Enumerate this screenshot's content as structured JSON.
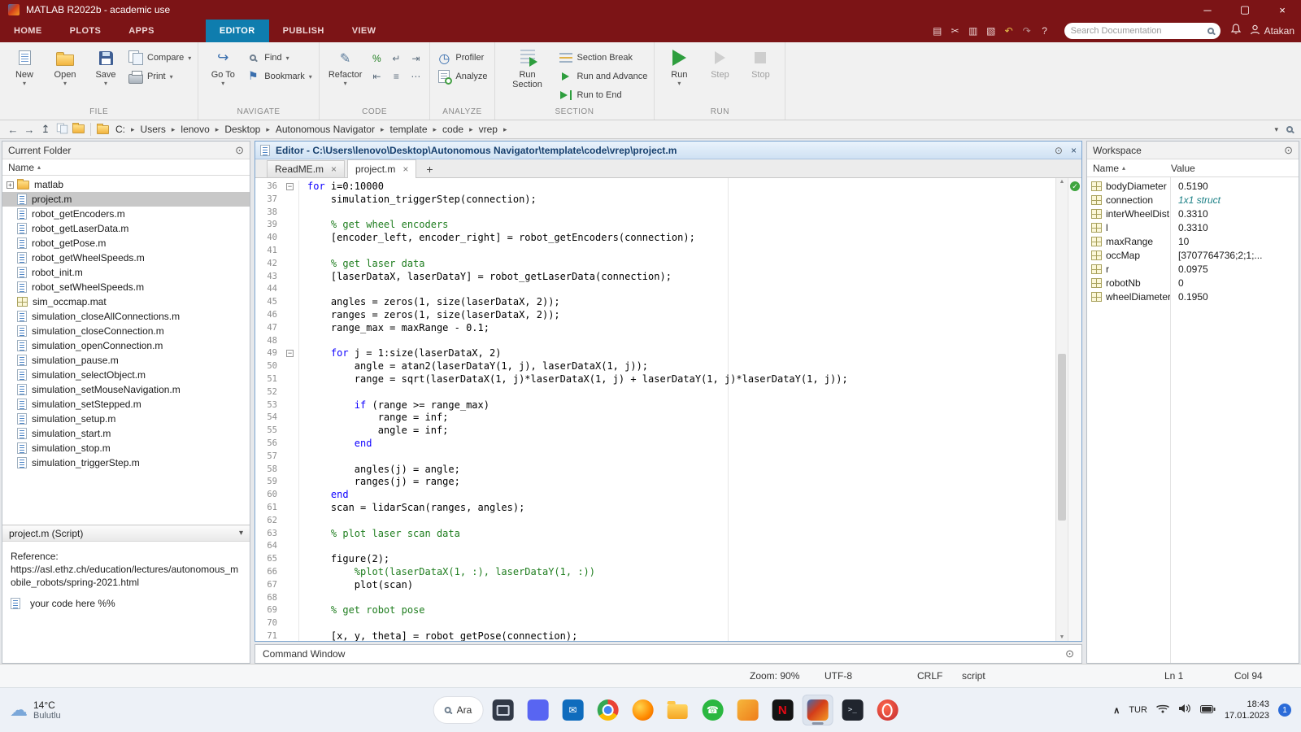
{
  "window": {
    "title": "MATLAB R2022b - academic use"
  },
  "ribbon": {
    "tabs": [
      {
        "label": "HOME"
      },
      {
        "label": "PLOTS"
      },
      {
        "label": "APPS"
      },
      {
        "label": "EDITOR",
        "active": true,
        "gap_before": true
      },
      {
        "label": "PUBLISH"
      },
      {
        "label": "VIEW"
      }
    ],
    "quick_access": [
      "save",
      "cut",
      "copy",
      "paste",
      "undo",
      "redo",
      "help"
    ],
    "search_placeholder": "Search Documentation",
    "user": "Atakan",
    "sections": [
      {
        "label": "FILE",
        "big": [
          {
            "label": "New",
            "icon": "new",
            "arrow": true
          },
          {
            "label": "Open",
            "icon": "open",
            "arrow": true
          },
          {
            "label": "Save",
            "icon": "save",
            "arrow": true
          }
        ],
        "small": [
          {
            "label": "Compare",
            "icon": "compare",
            "arrow": true
          },
          {
            "label": "Print",
            "icon": "print",
            "arrow": true
          }
        ]
      },
      {
        "label": "NAVIGATE",
        "big": [
          {
            "label": "Go To",
            "icon": "goto",
            "arrow": true
          }
        ],
        "small": [
          {
            "label": "Find",
            "icon": "find",
            "arrow": true
          },
          {
            "label": "Bookmark",
            "icon": "bookmark",
            "arrow": true
          }
        ]
      },
      {
        "label": "CODE",
        "big": [
          {
            "label": "Refactor",
            "icon": "refactor",
            "arrow": true
          }
        ],
        "grid": [
          [
            "percent",
            "wrap",
            "indent-right"
          ],
          [
            "indent-left",
            "lines",
            "more"
          ]
        ]
      },
      {
        "label": "ANALYZE",
        "small": [
          {
            "label": "Profiler",
            "icon": "profiler"
          },
          {
            "label": "Analyze",
            "icon": "analyze"
          }
        ]
      },
      {
        "label": "SECTION",
        "big": [
          {
            "label": "Run Section",
            "icon": "run-section"
          }
        ],
        "small": [
          {
            "label": "Section Break",
            "icon": "section-break"
          },
          {
            "label": "Run and Advance",
            "icon": "run-advance"
          },
          {
            "label": "Run to End",
            "icon": "run-end"
          }
        ]
      },
      {
        "label": "RUN",
        "big": [
          {
            "label": "Run",
            "icon": "run",
            "arrow": true
          },
          {
            "label": "Step",
            "icon": "step",
            "disabled": true
          },
          {
            "label": "Stop",
            "icon": "stop",
            "disabled": true
          }
        ]
      }
    ]
  },
  "address_bar": {
    "path": [
      "C:",
      "Users",
      "lenovo",
      "Desktop",
      "Autonomous Navigator",
      "template",
      "code",
      "vrep"
    ]
  },
  "current_folder": {
    "title": "Current Folder",
    "name_header": "Name",
    "files": [
      {
        "name": "matlab",
        "icon": "folder",
        "expandable": true
      },
      {
        "name": "project.m",
        "icon": "mfile",
        "selected": true
      },
      {
        "name": "robot_getEncoders.m",
        "icon": "mfile"
      },
      {
        "name": "robot_getLaserData.m",
        "icon": "mfile"
      },
      {
        "name": "robot_getPose.m",
        "icon": "mfile"
      },
      {
        "name": "robot_getWheelSpeeds.m",
        "icon": "mfile"
      },
      {
        "name": "robot_init.m",
        "icon": "mfile"
      },
      {
        "name": "robot_setWheelSpeeds.m",
        "icon": "mfile"
      },
      {
        "name": "sim_occmap.mat",
        "icon": "matfile"
      },
      {
        "name": "simulation_closeAllConnections.m",
        "icon": "mfile"
      },
      {
        "name": "simulation_closeConnection.m",
        "icon": "mfile"
      },
      {
        "name": "simulation_openConnection.m",
        "icon": "mfile"
      },
      {
        "name": "simulation_pause.m",
        "icon": "mfile"
      },
      {
        "name": "simulation_selectObject.m",
        "icon": "mfile"
      },
      {
        "name": "simulation_setMouseNavigation.m",
        "icon": "mfile"
      },
      {
        "name": "simulation_setStepped.m",
        "icon": "mfile"
      },
      {
        "name": "simulation_setup.m",
        "icon": "mfile"
      },
      {
        "name": "simulation_start.m",
        "icon": "mfile"
      },
      {
        "name": "simulation_stop.m",
        "icon": "mfile"
      },
      {
        "name": "simulation_triggerStep.m",
        "icon": "mfile"
      }
    ],
    "details": {
      "header": "project.m (Script)",
      "reference_label": "Reference:",
      "reference_url": "https://asl.ethz.ch/education/lectures/autonomous_mobile_robots/spring-2021.html",
      "note": "your code here %%"
    }
  },
  "editor": {
    "title": "Editor - C:\\Users\\lenovo\\Desktop\\Autonomous Navigator\\template\\code\\vrep\\project.m",
    "tabs": [
      {
        "label": "ReadME.m"
      },
      {
        "label": "project.m",
        "active": true
      }
    ],
    "lines": [
      {
        "n": 36,
        "fold": true,
        "text": "for i=0:10000"
      },
      {
        "n": 37,
        "text": "    simulation_triggerStep(connection);"
      },
      {
        "n": 38,
        "text": ""
      },
      {
        "n": 39,
        "text": "    % get wheel encoders"
      },
      {
        "n": 40,
        "text": "    [encoder_left, encoder_right] = robot_getEncoders(connection);"
      },
      {
        "n": 41,
        "text": ""
      },
      {
        "n": 42,
        "text": "    % get laser data"
      },
      {
        "n": 43,
        "text": "    [laserDataX, laserDataY] = robot_getLaserData(connection);"
      },
      {
        "n": 44,
        "text": ""
      },
      {
        "n": 45,
        "text": "    angles = zeros(1, size(laserDataX, 2));"
      },
      {
        "n": 46,
        "text": "    ranges = zeros(1, size(laserDataX, 2));"
      },
      {
        "n": 47,
        "text": "    range_max = maxRange - 0.1;"
      },
      {
        "n": 48,
        "text": ""
      },
      {
        "n": 49,
        "fold": true,
        "text": "    for j = 1:size(laserDataX, 2)"
      },
      {
        "n": 50,
        "text": "        angle = atan2(laserDataY(1, j), laserDataX(1, j));"
      },
      {
        "n": 51,
        "text": "        range = sqrt(laserDataX(1, j)*laserDataX(1, j) + laserDataY(1, j)*laserDataY(1, j));"
      },
      {
        "n": 52,
        "text": ""
      },
      {
        "n": 53,
        "text": "        if (range >= range_max)"
      },
      {
        "n": 54,
        "text": "            range = inf;"
      },
      {
        "n": 55,
        "text": "            angle = inf;"
      },
      {
        "n": 56,
        "text": "        end"
      },
      {
        "n": 57,
        "text": ""
      },
      {
        "n": 58,
        "text": "        angles(j) = angle;"
      },
      {
        "n": 59,
        "text": "        ranges(j) = range;"
      },
      {
        "n": 60,
        "text": "    end"
      },
      {
        "n": 61,
        "text": "    scan = lidarScan(ranges, angles);"
      },
      {
        "n": 62,
        "text": ""
      },
      {
        "n": 63,
        "text": "    % plot laser scan data"
      },
      {
        "n": 64,
        "text": ""
      },
      {
        "n": 65,
        "text": "    figure(2);"
      },
      {
        "n": 66,
        "text": "        %plot(laserDataX(1, :), laserDataY(1, :))"
      },
      {
        "n": 67,
        "text": "        plot(scan)"
      },
      {
        "n": 68,
        "text": ""
      },
      {
        "n": 69,
        "text": "    % get robot pose"
      },
      {
        "n": 70,
        "text": ""
      },
      {
        "n": 71,
        "text": "    [x, y, theta] = robot_getPose(connection);"
      }
    ]
  },
  "command_window": {
    "title": "Command Window"
  },
  "workspace": {
    "title": "Workspace",
    "name_header": "Name",
    "value_header": "Value",
    "variables": [
      {
        "name": "bodyDiameter",
        "value": "0.5190"
      },
      {
        "name": "connection",
        "value": "1x1 struct",
        "style": "struct"
      },
      {
        "name": "interWheelDist",
        "value": "0.3310"
      },
      {
        "name": "l",
        "value": "0.3310"
      },
      {
        "name": "maxRange",
        "value": "10"
      },
      {
        "name": "occMap",
        "value": "[3707764736;2;1;..."
      },
      {
        "name": "r",
        "value": "0.0975"
      },
      {
        "name": "robotNb",
        "value": "0"
      },
      {
        "name": "wheelDiameter",
        "value": "0.1950"
      }
    ]
  },
  "status_bar": {
    "zoom": "Zoom: 90%",
    "encoding": "UTF-8",
    "line_ending": "CRLF",
    "file_type": "script",
    "line": "Ln 1",
    "column": "Col 94"
  },
  "taskbar": {
    "weather": {
      "temperature": "14°C",
      "condition": "Bulutlu"
    },
    "search_label": "Ara",
    "apps": [
      {
        "icon": "taskview"
      },
      {
        "icon": "discord"
      },
      {
        "icon": "outlook"
      },
      {
        "icon": "chrome"
      },
      {
        "icon": "firefox"
      },
      {
        "icon": "explorer"
      },
      {
        "icon": "whatsapp"
      },
      {
        "icon": "store"
      },
      {
        "icon": "netflix"
      },
      {
        "icon": "matlab",
        "active": true
      },
      {
        "icon": "terminal"
      },
      {
        "icon": "opera"
      }
    ],
    "tray": {
      "language": "TUR",
      "time": "18:43",
      "date": "17.01.2023",
      "notification_count": "1"
    }
  }
}
